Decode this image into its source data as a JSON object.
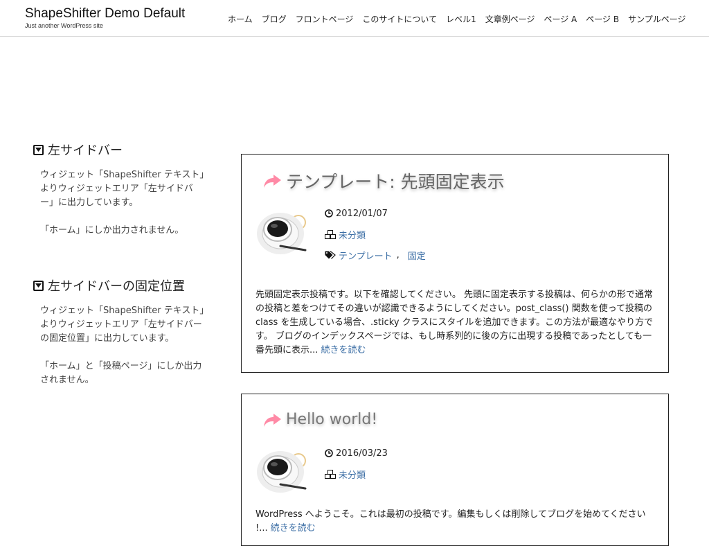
{
  "site": {
    "title": "ShapeShifter Demo Default",
    "description": "Just another WordPress site"
  },
  "nav": [
    "ホーム",
    "ブログ",
    "フロントページ",
    "このサイトについて",
    "レベル1",
    "文章例ページ",
    "ページ A",
    "ページ B",
    "サンプルページ"
  ],
  "sidebar": {
    "widgets": [
      {
        "title": "左サイドバー",
        "paragraphs": [
          "ウィジェット「ShapeShifter テキスト」よりウィジェットエリア「左サイドバー」に出力しています。",
          "「ホーム」にしか出力されません。"
        ]
      },
      {
        "title": "左サイドバーの固定位置",
        "paragraphs": [
          "ウィジェット「ShapeShifter テキスト」よりウィジェットエリア「左サイドバーの固定位置」に出力しています。",
          "「ホーム」と「投稿ページ」にしか出力されません。"
        ]
      }
    ]
  },
  "posts": [
    {
      "title": "テンプレート: 先頭固定表示",
      "date": "2012/01/07",
      "category": "未分類",
      "tags": [
        "テンプレート",
        "固定"
      ],
      "tag_separator": ",",
      "excerpt": "先頭固定表示投稿です。以下を確認してください。 先頭に固定表示する投稿は、何らかの形で通常の投稿と差をつけてその違いが認識できるようにしてください。post_class() 関数を使って投稿の class を生成している場合、.sticky クラスにスタイルを追加できます。この方法が最適なやり方です。 ブログのインデックスページでは、もし時系列的に後の方に出現する投稿であったとしても一番先頭に表示...",
      "read_more": "続きを読む"
    },
    {
      "title": "Hello world!",
      "date": "2016/03/23",
      "category": "未分類",
      "excerpt": "WordPress へようこそ。これは最初の投稿です。編集もしくは削除してブログを始めてください !...",
      "read_more": "続きを読む"
    }
  ],
  "colors": {
    "accent_arrow": "#ff8aa6",
    "link": "#3b6ea5"
  },
  "icons": {
    "widget": "caret-square-down-icon",
    "post_title": "share-arrow-icon",
    "date": "clock-icon",
    "category": "cubes-icon",
    "tags": "tags-icon"
  }
}
